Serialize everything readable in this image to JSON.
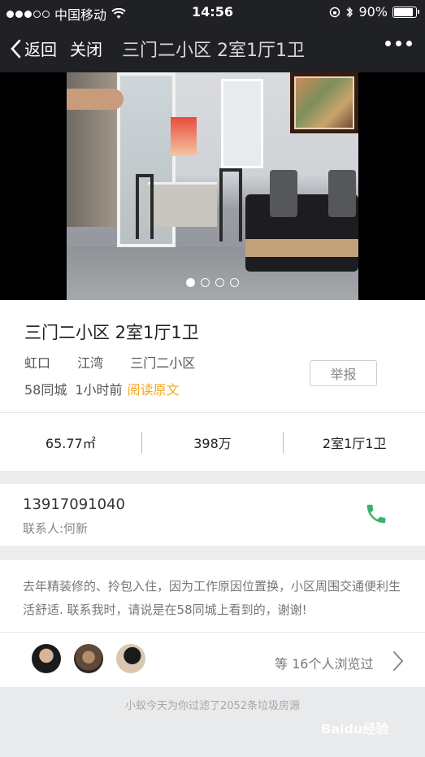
{
  "status_bar": {
    "carrier": "中国移动",
    "time": "14:56",
    "battery": "90%",
    "battery_level": 0.9
  },
  "nav": {
    "back_label": "返回",
    "close_label": "关闭",
    "title": "三门二小区 2室1厅1卫"
  },
  "gallery": {
    "page_count": 4,
    "active_index": 0
  },
  "listing": {
    "title": "三门二小区 2室1厅1卫",
    "district": [
      "虹口",
      "江湾",
      "三门二小区"
    ],
    "source": "58同城",
    "posted": "1小时前",
    "read_original": "阅读原文",
    "report_label": "举报"
  },
  "stats": {
    "area": "65.77㎡",
    "price": "398万",
    "layout": "2室1厅1卫"
  },
  "contact": {
    "phone": "13917091040",
    "name": "联系人:何新"
  },
  "description": "去年精装修的、拎包入住，因为工作原因位置换，小区周围交通便利生活舒适. 联系我时，请说是在58同城上看到的，谢谢!",
  "viewers": {
    "count_text": "等 16个人浏览过"
  },
  "footer": {
    "filter_text": "小蚁今天为你过滤了2052条垃圾房源"
  },
  "watermark": "Baidu经验",
  "colors": {
    "nav_bg": "#202125",
    "accent": "#f5a623",
    "phone_green": "#3bb46e"
  }
}
